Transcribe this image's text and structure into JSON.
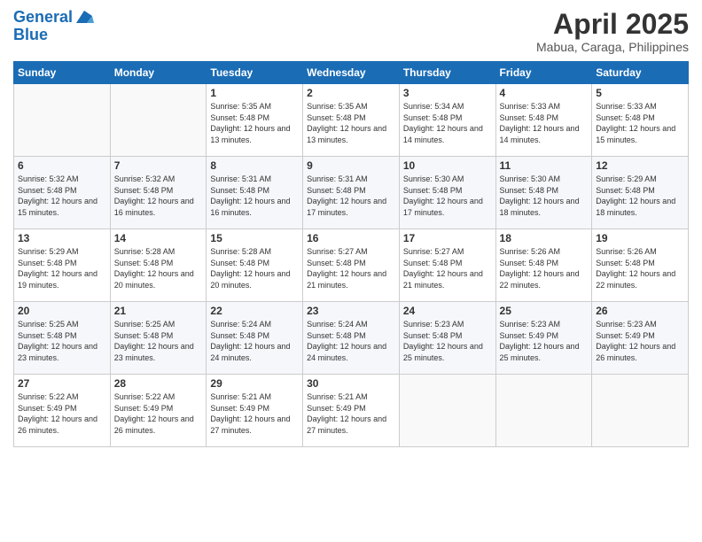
{
  "logo": {
    "line1": "General",
    "line2": "Blue"
  },
  "title": "April 2025",
  "location": "Mabua, Caraga, Philippines",
  "weekdays": [
    "Sunday",
    "Monday",
    "Tuesday",
    "Wednesday",
    "Thursday",
    "Friday",
    "Saturday"
  ],
  "weeks": [
    [
      {
        "day": "",
        "sunrise": "",
        "sunset": "",
        "daylight": ""
      },
      {
        "day": "",
        "sunrise": "",
        "sunset": "",
        "daylight": ""
      },
      {
        "day": "1",
        "sunrise": "Sunrise: 5:35 AM",
        "sunset": "Sunset: 5:48 PM",
        "daylight": "Daylight: 12 hours and 13 minutes."
      },
      {
        "day": "2",
        "sunrise": "Sunrise: 5:35 AM",
        "sunset": "Sunset: 5:48 PM",
        "daylight": "Daylight: 12 hours and 13 minutes."
      },
      {
        "day": "3",
        "sunrise": "Sunrise: 5:34 AM",
        "sunset": "Sunset: 5:48 PM",
        "daylight": "Daylight: 12 hours and 14 minutes."
      },
      {
        "day": "4",
        "sunrise": "Sunrise: 5:33 AM",
        "sunset": "Sunset: 5:48 PM",
        "daylight": "Daylight: 12 hours and 14 minutes."
      },
      {
        "day": "5",
        "sunrise": "Sunrise: 5:33 AM",
        "sunset": "Sunset: 5:48 PM",
        "daylight": "Daylight: 12 hours and 15 minutes."
      }
    ],
    [
      {
        "day": "6",
        "sunrise": "Sunrise: 5:32 AM",
        "sunset": "Sunset: 5:48 PM",
        "daylight": "Daylight: 12 hours and 15 minutes."
      },
      {
        "day": "7",
        "sunrise": "Sunrise: 5:32 AM",
        "sunset": "Sunset: 5:48 PM",
        "daylight": "Daylight: 12 hours and 16 minutes."
      },
      {
        "day": "8",
        "sunrise": "Sunrise: 5:31 AM",
        "sunset": "Sunset: 5:48 PM",
        "daylight": "Daylight: 12 hours and 16 minutes."
      },
      {
        "day": "9",
        "sunrise": "Sunrise: 5:31 AM",
        "sunset": "Sunset: 5:48 PM",
        "daylight": "Daylight: 12 hours and 17 minutes."
      },
      {
        "day": "10",
        "sunrise": "Sunrise: 5:30 AM",
        "sunset": "Sunset: 5:48 PM",
        "daylight": "Daylight: 12 hours and 17 minutes."
      },
      {
        "day": "11",
        "sunrise": "Sunrise: 5:30 AM",
        "sunset": "Sunset: 5:48 PM",
        "daylight": "Daylight: 12 hours and 18 minutes."
      },
      {
        "day": "12",
        "sunrise": "Sunrise: 5:29 AM",
        "sunset": "Sunset: 5:48 PM",
        "daylight": "Daylight: 12 hours and 18 minutes."
      }
    ],
    [
      {
        "day": "13",
        "sunrise": "Sunrise: 5:29 AM",
        "sunset": "Sunset: 5:48 PM",
        "daylight": "Daylight: 12 hours and 19 minutes."
      },
      {
        "day": "14",
        "sunrise": "Sunrise: 5:28 AM",
        "sunset": "Sunset: 5:48 PM",
        "daylight": "Daylight: 12 hours and 20 minutes."
      },
      {
        "day": "15",
        "sunrise": "Sunrise: 5:28 AM",
        "sunset": "Sunset: 5:48 PM",
        "daylight": "Daylight: 12 hours and 20 minutes."
      },
      {
        "day": "16",
        "sunrise": "Sunrise: 5:27 AM",
        "sunset": "Sunset: 5:48 PM",
        "daylight": "Daylight: 12 hours and 21 minutes."
      },
      {
        "day": "17",
        "sunrise": "Sunrise: 5:27 AM",
        "sunset": "Sunset: 5:48 PM",
        "daylight": "Daylight: 12 hours and 21 minutes."
      },
      {
        "day": "18",
        "sunrise": "Sunrise: 5:26 AM",
        "sunset": "Sunset: 5:48 PM",
        "daylight": "Daylight: 12 hours and 22 minutes."
      },
      {
        "day": "19",
        "sunrise": "Sunrise: 5:26 AM",
        "sunset": "Sunset: 5:48 PM",
        "daylight": "Daylight: 12 hours and 22 minutes."
      }
    ],
    [
      {
        "day": "20",
        "sunrise": "Sunrise: 5:25 AM",
        "sunset": "Sunset: 5:48 PM",
        "daylight": "Daylight: 12 hours and 23 minutes."
      },
      {
        "day": "21",
        "sunrise": "Sunrise: 5:25 AM",
        "sunset": "Sunset: 5:48 PM",
        "daylight": "Daylight: 12 hours and 23 minutes."
      },
      {
        "day": "22",
        "sunrise": "Sunrise: 5:24 AM",
        "sunset": "Sunset: 5:48 PM",
        "daylight": "Daylight: 12 hours and 24 minutes."
      },
      {
        "day": "23",
        "sunrise": "Sunrise: 5:24 AM",
        "sunset": "Sunset: 5:48 PM",
        "daylight": "Daylight: 12 hours and 24 minutes."
      },
      {
        "day": "24",
        "sunrise": "Sunrise: 5:23 AM",
        "sunset": "Sunset: 5:48 PM",
        "daylight": "Daylight: 12 hours and 25 minutes."
      },
      {
        "day": "25",
        "sunrise": "Sunrise: 5:23 AM",
        "sunset": "Sunset: 5:49 PM",
        "daylight": "Daylight: 12 hours and 25 minutes."
      },
      {
        "day": "26",
        "sunrise": "Sunrise: 5:23 AM",
        "sunset": "Sunset: 5:49 PM",
        "daylight": "Daylight: 12 hours and 26 minutes."
      }
    ],
    [
      {
        "day": "27",
        "sunrise": "Sunrise: 5:22 AM",
        "sunset": "Sunset: 5:49 PM",
        "daylight": "Daylight: 12 hours and 26 minutes."
      },
      {
        "day": "28",
        "sunrise": "Sunrise: 5:22 AM",
        "sunset": "Sunset: 5:49 PM",
        "daylight": "Daylight: 12 hours and 26 minutes."
      },
      {
        "day": "29",
        "sunrise": "Sunrise: 5:21 AM",
        "sunset": "Sunset: 5:49 PM",
        "daylight": "Daylight: 12 hours and 27 minutes."
      },
      {
        "day": "30",
        "sunrise": "Sunrise: 5:21 AM",
        "sunset": "Sunset: 5:49 PM",
        "daylight": "Daylight: 12 hours and 27 minutes."
      },
      {
        "day": "",
        "sunrise": "",
        "sunset": "",
        "daylight": ""
      },
      {
        "day": "",
        "sunrise": "",
        "sunset": "",
        "daylight": ""
      },
      {
        "day": "",
        "sunrise": "",
        "sunset": "",
        "daylight": ""
      }
    ]
  ]
}
